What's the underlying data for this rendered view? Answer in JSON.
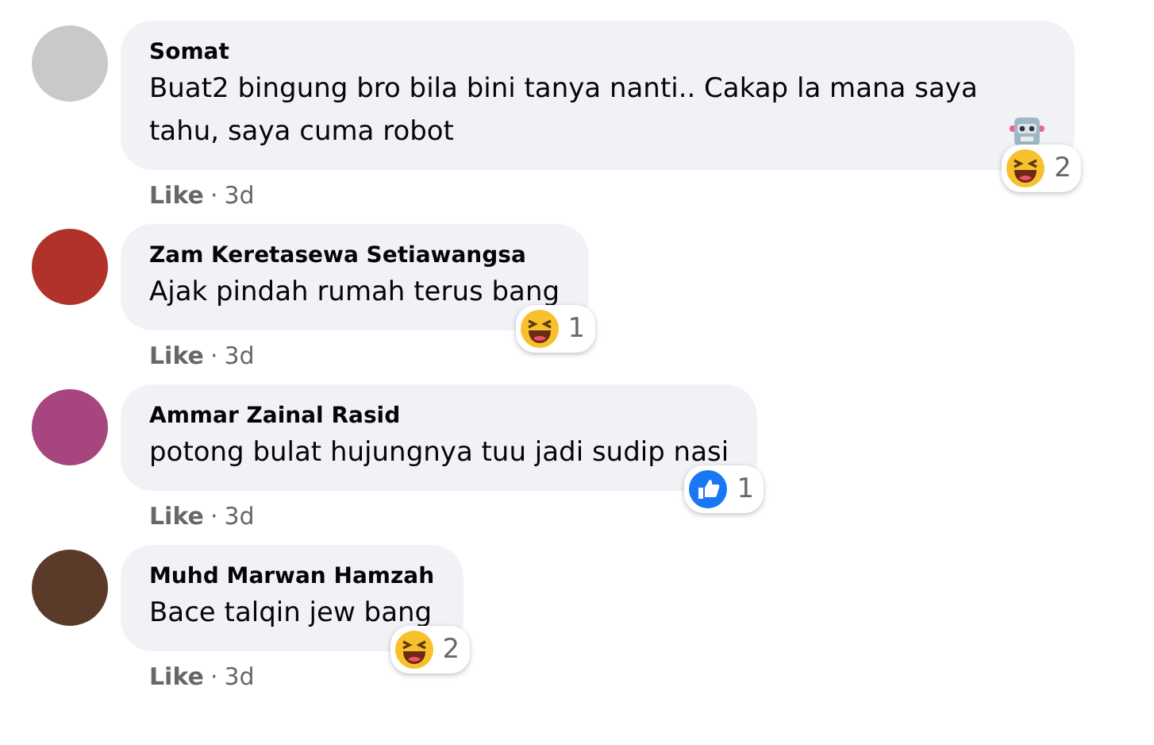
{
  "comments": [
    {
      "author": "Somat",
      "text": "Buat2 bingung bro bila bini tanya nanti.. Cakap la mana saya tahu, saya cuma robot",
      "inline_icon": {
        "kind": "robot"
      },
      "reaction": {
        "kind": "haha",
        "count": "2"
      },
      "like": "Like",
      "separator": "·",
      "time": "3d"
    },
    {
      "author": "Zam Keretasewa Setiawangsa",
      "text": "Ajak pindah rumah terus bang",
      "reaction": {
        "kind": "haha",
        "count": "1"
      },
      "like": "Like",
      "separator": "·",
      "time": "3d"
    },
    {
      "author": "Ammar Zainal Rasid",
      "text": "potong bulat hujungnya tuu jadi sudip nasi",
      "reaction": {
        "kind": "like",
        "count": "1"
      },
      "like": "Like",
      "separator": "·",
      "time": "3d"
    },
    {
      "author": "Muhd Marwan Hamzah",
      "text": "Bace talqin jew bang",
      "reaction": {
        "kind": "haha",
        "count": "2"
      },
      "like": "Like",
      "separator": "·",
      "time": "3d"
    }
  ]
}
